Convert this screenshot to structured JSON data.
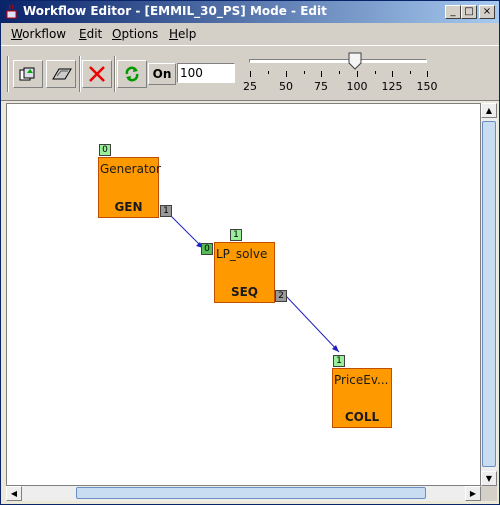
{
  "window": {
    "title": "Workflow Editor - [EMMIL_30_PS] Mode - Edit"
  },
  "menubar": {
    "items": [
      "Workflow",
      "Edit",
      "Options",
      "Help"
    ]
  },
  "toolbar": {
    "on_label": "On",
    "zoom_value": "100",
    "slider": {
      "min": 25,
      "max": 150,
      "value": 100,
      "tick_labels": [
        "25",
        "50",
        "75",
        "100",
        "125",
        "150"
      ]
    }
  },
  "nodes": [
    {
      "name": "Generator",
      "kind": "GEN",
      "input_port": "0",
      "output_port": "1"
    },
    {
      "name": "LP_solve",
      "kind": "SEQ",
      "input_port": "1",
      "incoming_port": "0",
      "output_port": "2"
    },
    {
      "name": "PriceEv...",
      "kind": "COLL",
      "input_port": "1"
    }
  ],
  "icons": [
    "import-icon",
    "export-icon",
    "delete-icon",
    "refresh-icon"
  ]
}
